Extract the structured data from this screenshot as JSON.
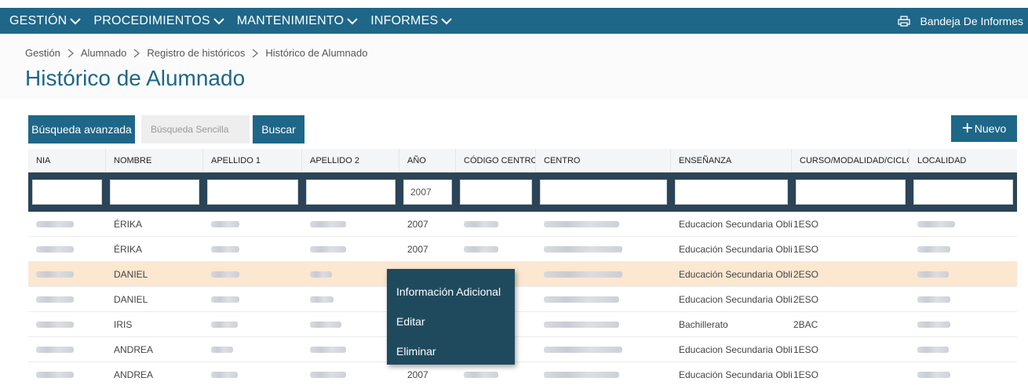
{
  "nav": {
    "items": [
      {
        "label": "GESTIÓN"
      },
      {
        "label": "PROCEDIMIENTOS"
      },
      {
        "label": "MANTENIMIENTO"
      },
      {
        "label": "INFORMES"
      }
    ],
    "right_label": "Bandeja De Informes"
  },
  "breadcrumb": [
    "Gestión",
    "Alumnado",
    "Registro de históricos",
    "Histórico de Alumnado"
  ],
  "page_title": "Histórico de Alumnado",
  "search": {
    "advanced_label": "Búsqueda avanzada",
    "simple_placeholder": "Búsqueda Sencilla",
    "search_label": "Buscar",
    "new_label": "Nuevo"
  },
  "table": {
    "columns": [
      "NIA",
      "NOMBRE",
      "APELLIDO 1",
      "APELLIDO 2",
      "AÑO",
      "CÓDIGO CENTRO",
      "CENTRO",
      "ENSEÑANZA",
      "CURSO/MODALIDAD/CICLO/PRC",
      "LOCALIDAD"
    ],
    "filter_values": [
      "",
      "",
      "",
      "",
      "2007",
      "",
      "",
      "",
      "",
      ""
    ],
    "rows": [
      {
        "nombre": "ÉRIKA",
        "anio": "2007",
        "ensenanza": "Educacion Secundaria Obligator",
        "curso": "1ESO"
      },
      {
        "nombre": "ÉRIKA",
        "anio": "2007",
        "ensenanza": "Educación Secundaria Obligator",
        "curso": "1ESO"
      },
      {
        "nombre": "DANIEL",
        "anio": "",
        "ensenanza": "Educación Secundaria Obligator",
        "curso": "2ESO"
      },
      {
        "nombre": "DANIEL",
        "anio": "",
        "ensenanza": "Educacion Secundaria Obligator",
        "curso": "2ESO"
      },
      {
        "nombre": "IRIS",
        "anio": "",
        "ensenanza": "Bachillerato",
        "curso": "2BAC"
      },
      {
        "nombre": "ANDREA",
        "anio": "",
        "ensenanza": "Educacion Secundaria Obligator",
        "curso": "1ESO"
      },
      {
        "nombre": "ANDREA",
        "anio": "2007",
        "ensenanza": "Educación Secundaria Obligator",
        "curso": "1ESO"
      }
    ]
  },
  "context_menu": {
    "items": [
      "Información Adicional",
      "Editar",
      "Eliminar"
    ]
  },
  "colors": {
    "primary": "#1e6788",
    "filter_bar": "#2b4457",
    "context_menu": "#1f4a5e",
    "selected_row": "#fce7d1"
  }
}
